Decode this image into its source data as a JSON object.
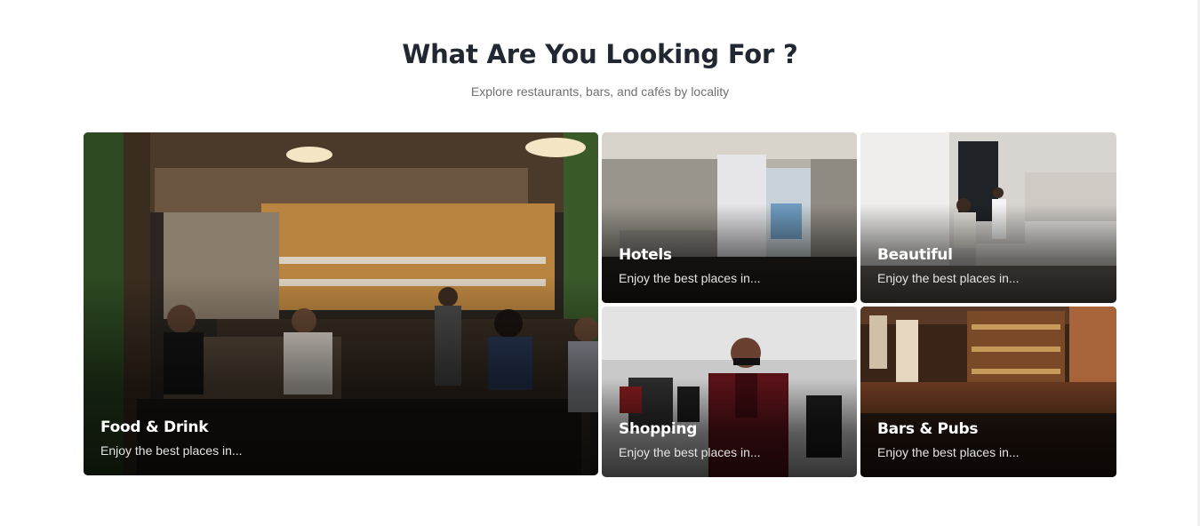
{
  "section": {
    "title": "What Are You Looking For ?",
    "subtitle": "Explore restaurants, bars, and cafés by locality"
  },
  "categories": [
    {
      "title": "Food & Drink",
      "description": "Enjoy the best places in..."
    },
    {
      "title": "Hotels",
      "description": "Enjoy the best places in..."
    },
    {
      "title": "Beautiful",
      "description": "Enjoy the best places in..."
    },
    {
      "title": "Shopping",
      "description": "Enjoy the best places in..."
    },
    {
      "title": "Bars & Pubs",
      "description": "Enjoy the best places in..."
    }
  ]
}
